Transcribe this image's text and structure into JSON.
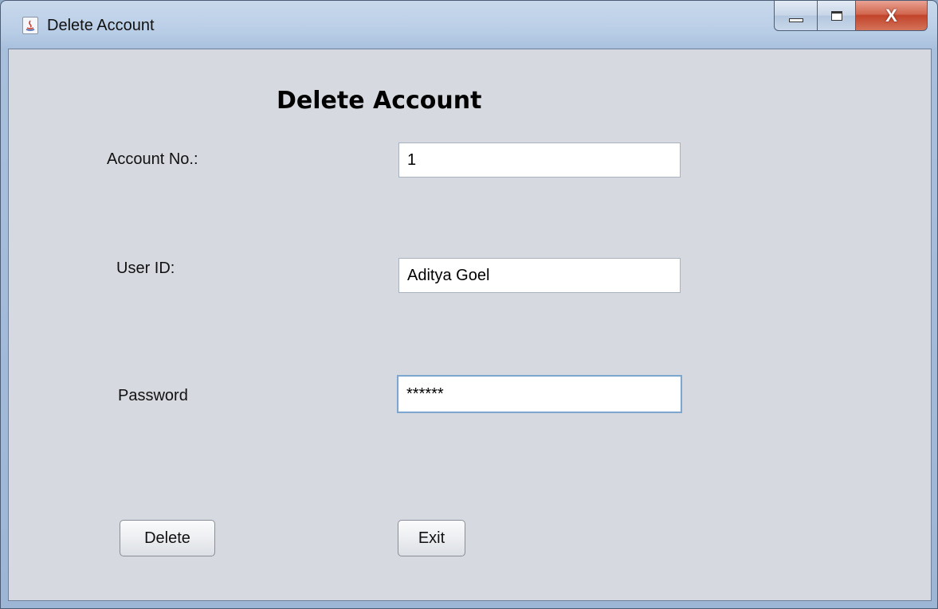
{
  "window": {
    "title": "Delete Account",
    "controls": {
      "minimize_icon": "minimize-icon",
      "maximize_icon": "maximize-icon",
      "close_glyph": "X",
      "close_icon": "close-icon"
    },
    "app_icon": "java-icon"
  },
  "form": {
    "heading": "Delete Account",
    "account_no": {
      "label": "Account No.:",
      "value": "1"
    },
    "user_id": {
      "label": "User ID:",
      "value": "Aditya Goel"
    },
    "password": {
      "label": "Password",
      "value": "******"
    },
    "delete_label": "Delete",
    "exit_label": "Exit"
  },
  "colors": {
    "client_bg": "#d6d9df",
    "close_button": "#c1442a",
    "focus_border": "#7ea7cf"
  }
}
